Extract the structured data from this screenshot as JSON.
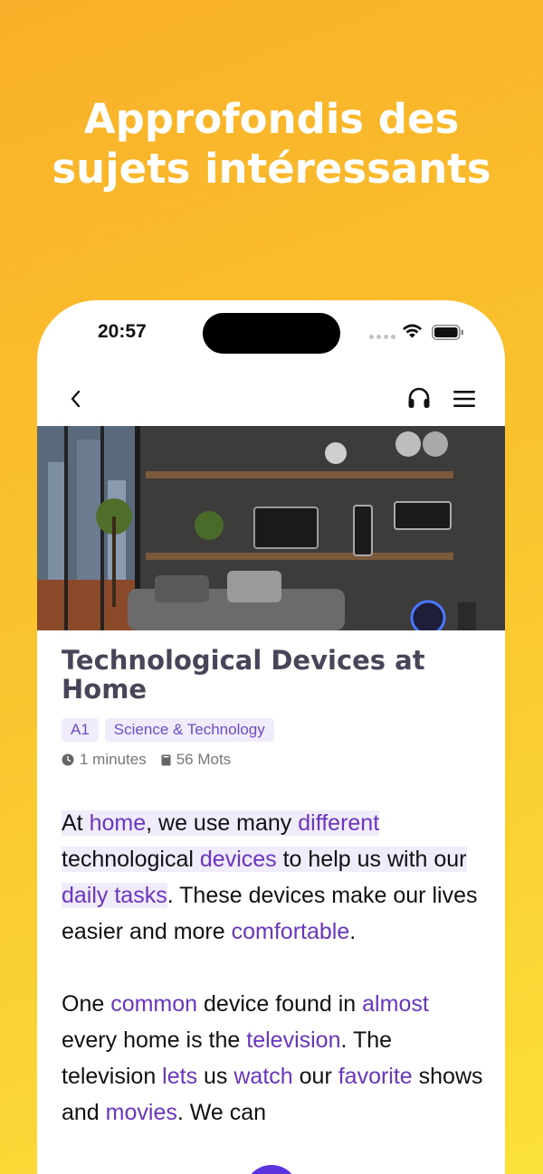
{
  "headline": {
    "line1": "Approfondis des",
    "line2": "sujets intéressants"
  },
  "status_bar": {
    "time": "20:57",
    "icons": [
      "signal-dots-icon",
      "wifi-icon",
      "battery-icon"
    ]
  },
  "nav": {
    "icons": [
      "chevron-left-icon",
      "headphones-icon",
      "hamburger-menu-icon"
    ]
  },
  "article": {
    "title": "Technological Devices at Home",
    "tags": [
      "A1",
      "Science & Technology"
    ],
    "duration": "1 minutes",
    "word_count": "56 Mots",
    "p1": {
      "s1": "At ",
      "w_home": "home",
      "s2": ", we use many ",
      "w_different": "different",
      "s3": "technological ",
      "w_devices": "devices",
      "s4": " to help us",
      "s5": "with our ",
      "w_daily": "daily tasks",
      "s6": ". These devices make our lives easier and more ",
      "w_comfortable": "comfortable",
      "s7": "."
    },
    "p2": {
      "s1": "One ",
      "w_common": "common",
      "s2": " device found in ",
      "w_almost": "almost",
      "s3": " every home is the ",
      "w_television": "television",
      "s4": ". The television ",
      "w_lets": "lets",
      "s5": " us ",
      "w_watch": "watch",
      "s6": " our ",
      "w_favorite": "favorite",
      "s7": " shows and ",
      "w_movies": "movies",
      "s8": ". We can"
    }
  },
  "colors": {
    "background_top": "#f9b02a",
    "background_bottom": "#fbe03a",
    "accent": "#6a35c0",
    "highlight": "#f1ecfb",
    "title": "#4a4458"
  }
}
